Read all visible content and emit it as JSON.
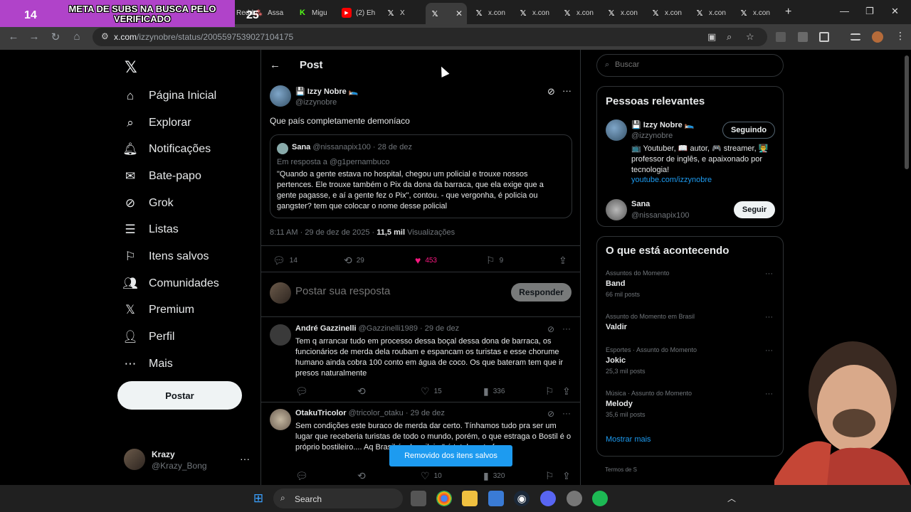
{
  "stream": {
    "sub_count": "14",
    "banner_title": "META DE SUBS NA BUSCA PELO VERIFICADO",
    "sub_goal": "25"
  },
  "browser": {
    "tabs": [
      {
        "label": "Redd",
        "icon": "reddit-icon"
      },
      {
        "label": "Assa",
        "icon": "asana-icon"
      },
      {
        "label": "Migu",
        "icon": "kick-icon"
      },
      {
        "label": "(2) Eh",
        "icon": "youtube-icon"
      },
      {
        "label": "X",
        "icon": "x-icon"
      },
      {
        "label": "",
        "icon": "x-icon",
        "active": true
      },
      {
        "label": "x.con",
        "icon": "x-icon"
      },
      {
        "label": "x.con",
        "icon": "x-icon"
      },
      {
        "label": "x.con",
        "icon": "x-icon"
      },
      {
        "label": "x.con",
        "icon": "x-icon"
      },
      {
        "label": "x.con",
        "icon": "x-icon"
      },
      {
        "label": "x.con",
        "icon": "x-icon"
      },
      {
        "label": "x.con",
        "icon": "x-icon"
      }
    ],
    "url_host": "x.com",
    "url_path": "/izzynobre/status/2005597539027104175"
  },
  "nav": {
    "items": [
      {
        "label": "Página Inicial",
        "icon": "home-icon"
      },
      {
        "label": "Explorar",
        "icon": "search-icon"
      },
      {
        "label": "Notificações",
        "icon": "bell-icon"
      },
      {
        "label": "Bate-papo",
        "icon": "mail-icon"
      },
      {
        "label": "Grok",
        "icon": "grok-icon"
      },
      {
        "label": "Listas",
        "icon": "list-icon"
      },
      {
        "label": "Itens salvos",
        "icon": "bookmark-icon"
      },
      {
        "label": "Comunidades",
        "icon": "people-icon"
      },
      {
        "label": "Premium",
        "icon": "x-icon"
      },
      {
        "label": "Perfil",
        "icon": "user-icon"
      },
      {
        "label": "Mais",
        "icon": "more-circle-icon"
      }
    ],
    "post_label": "Postar",
    "me_name": "Krazy",
    "me_handle": "@Krazy_Bong"
  },
  "post": {
    "header_title": "Post",
    "author_name": "💾 Izzy Nobre 🛌",
    "author_handle": "@izzynobre",
    "text": "Que país completamente demoníaco",
    "quote": {
      "name": "Sana",
      "handle": "@nissanapix100",
      "date": "· 28 de dez",
      "reply_to_prefix": "Em resposta a",
      "reply_to_handle": "@g1pernambuco",
      "text": "\"Quando a gente estava no hospital, chegou um policial e trouxe nossos pertences. Ele trouxe também o Pix da dona da barraca, que ela exige que a gente pagasse, e aí a gente fez o Pix\", contou. - que vergonha, é policia ou gangster? tem que colocar o nome desse policial"
    },
    "timestamp": "8:11 AM · 29 de dez de 2025 ·",
    "views_count": "11,5 mil",
    "views_label": "Visualizações",
    "replies": "14",
    "reposts": "29",
    "likes": "453",
    "bookmarks": "9",
    "reply_placeholder": "Postar sua resposta",
    "reply_button": "Responder"
  },
  "replies": [
    {
      "name": "André Gazzinelli",
      "handle": "@Gazzinelli1989",
      "date": "· 29 de dez",
      "text": "Tem q arrancar tudo em processo dessa boçal dessa dona de barraca, os funcionários de merda dela roubam e espancam os turistas e esse chorume humano ainda cobra 100 conto em água de coco. Os que bateram tem que ir presos naturalmente",
      "replies": "",
      "reposts": "",
      "likes": "15",
      "views": "336"
    },
    {
      "name": "OtakuTricolor",
      "handle": "@tricolor_otaku",
      "date": "· 29 de dez",
      "text": "Sem condições este buraco de merda dar certo. Tínhamos tudo pra ser um lugar que receberia turistas de todo o mundo, porém, o que estraga o Bostil é o próprio bostileiro.... Aq                                            Brasil é o brasileiro\" é totalmente fa",
      "replies": "",
      "reposts": "",
      "likes": "10",
      "views": "320"
    }
  ],
  "toast": "Removido dos itens salvos",
  "sidebar": {
    "search_placeholder": "Buscar",
    "relevant_title": "Pessoas relevantes",
    "people": [
      {
        "name": "💾 Izzy Nobre 🛌",
        "handle": "@izzynobre",
        "button": "Seguindo",
        "bio": "📺 Youtuber, 📖 autor, 🎮 streamer, 👨‍🏫 professor de inglês, e apaixonado por tecnologia!",
        "link": "youtube.com/izzynobre"
      },
      {
        "name": "Sana",
        "handle": "@nissanapix100",
        "button": "Seguir"
      }
    ],
    "trends_title": "O que está acontecendo",
    "trends": [
      {
        "category": "Assuntos do Momento",
        "name": "Band",
        "count": "66 mil posts"
      },
      {
        "category": "Assunto do Momento em Brasil",
        "name": "Valdir",
        "count": ""
      },
      {
        "category": "Esportes · Assunto do Momento",
        "name": "Jokic",
        "count": "25,3 mil posts"
      },
      {
        "category": "Música · Assunto do Momento",
        "name": "Melody",
        "count": "35,6 mil posts"
      }
    ],
    "show_more": "Mostrar mais",
    "terms": "Termos de S"
  },
  "taskbar": {
    "search_label": "Search"
  }
}
